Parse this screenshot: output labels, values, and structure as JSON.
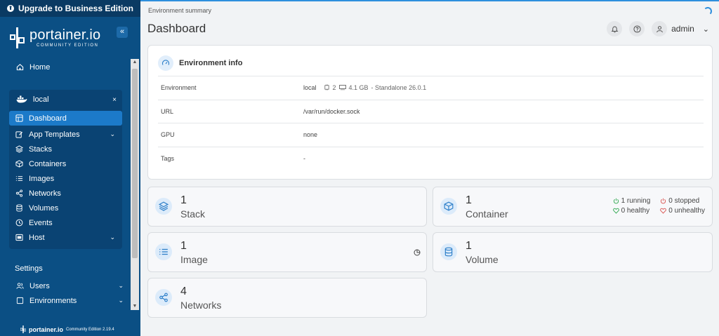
{
  "sidebar": {
    "upgrade_label": "Upgrade to Business Edition",
    "logo_name": "portainer.io",
    "logo_edition": "COMMUNITY EDITION",
    "collapse_label": "«",
    "home_label": "Home",
    "environment": {
      "name": "local",
      "close_label": "×",
      "items": [
        {
          "label": "Dashboard"
        },
        {
          "label": "App Templates"
        },
        {
          "label": "Stacks"
        },
        {
          "label": "Containers"
        },
        {
          "label": "Images"
        },
        {
          "label": "Networks"
        },
        {
          "label": "Volumes"
        },
        {
          "label": "Events"
        },
        {
          "label": "Host"
        }
      ]
    },
    "settings_label": "Settings",
    "settings_items": [
      {
        "label": "Users"
      },
      {
        "label": "Environments"
      }
    ],
    "footer_name": "portainer.io",
    "footer_edition": "Community Edition 2.19.4"
  },
  "header": {
    "breadcrumb": "Environment summary",
    "title": "Dashboard",
    "user": "admin"
  },
  "env_info": {
    "title": "Environment info",
    "rows": {
      "environment": {
        "key": "Environment",
        "name": "local",
        "cpu": "2",
        "memory": "4.1 GB",
        "details": "- Standalone 26.0.1"
      },
      "url": {
        "key": "URL",
        "value": "/var/run/docker.sock"
      },
      "gpu": {
        "key": "GPU",
        "value": "none"
      },
      "tags": {
        "key": "Tags",
        "value": "-"
      }
    }
  },
  "stats": {
    "stack": {
      "count": "1",
      "label": "Stack"
    },
    "container": {
      "count": "1",
      "label": "Container",
      "running": "1 running",
      "stopped": "0 stopped",
      "healthy": "0 healthy",
      "unhealthy": "0 unhealthy"
    },
    "image": {
      "count": "1",
      "label": "Image"
    },
    "volume": {
      "count": "1",
      "label": "Volume"
    },
    "networks": {
      "count": "4",
      "label": "Networks"
    }
  },
  "colors": {
    "sidebar_bg": "#0b4f84",
    "active_item": "#1c7ac9",
    "running": "#2fa84f",
    "stopped": "#d9534f"
  }
}
